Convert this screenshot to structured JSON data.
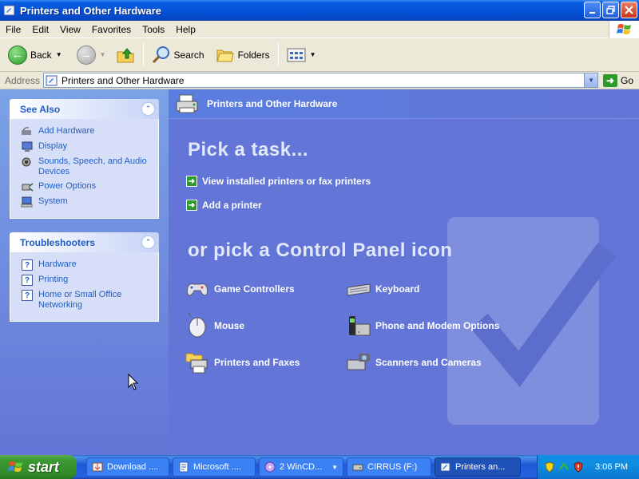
{
  "window": {
    "title": "Printers and Other Hardware"
  },
  "menu": [
    "File",
    "Edit",
    "View",
    "Favorites",
    "Tools",
    "Help"
  ],
  "toolbar": {
    "back": "Back",
    "search": "Search",
    "folders": "Folders"
  },
  "address": {
    "label": "Address",
    "value": "Printers and Other Hardware",
    "go": "Go"
  },
  "see_also": {
    "title": "See Also",
    "items": [
      {
        "label": "Add Hardware",
        "icon": "add-hardware-icon"
      },
      {
        "label": "Display",
        "icon": "display-icon"
      },
      {
        "label": "Sounds, Speech, and Audio Devices",
        "icon": "sounds-icon"
      },
      {
        "label": "Power Options",
        "icon": "power-icon"
      },
      {
        "label": "System",
        "icon": "system-icon"
      }
    ]
  },
  "troubleshooters": {
    "title": "Troubleshooters",
    "items": [
      {
        "label": "Hardware",
        "icon": "help-icon"
      },
      {
        "label": "Printing",
        "icon": "help-icon"
      },
      {
        "label": "Home or Small Office Networking",
        "icon": "help-icon"
      }
    ]
  },
  "content": {
    "banner": "Printers and Other Hardware",
    "pick_task": "Pick a task...",
    "tasks": [
      "View installed printers or fax printers",
      "Add a printer"
    ],
    "pick_icon": "or pick a Control Panel icon",
    "icons": [
      {
        "label": "Game Controllers",
        "icon": "game-controller-icon"
      },
      {
        "label": "Keyboard",
        "icon": "keyboard-icon"
      },
      {
        "label": "Mouse",
        "icon": "mouse-icon"
      },
      {
        "label": "Phone and Modem Options",
        "icon": "phone-modem-icon"
      },
      {
        "label": "Printers and Faxes",
        "icon": "printer-fax-icon"
      },
      {
        "label": "Scanners and Cameras",
        "icon": "scanner-camera-icon"
      }
    ]
  },
  "taskbar": {
    "start": "start",
    "buttons": [
      {
        "label": "Download ...."
      },
      {
        "label": "Microsoft ...."
      },
      {
        "label": "2 WinCD..."
      },
      {
        "label": "CIRRUS (F:)"
      },
      {
        "label": "Printers an..."
      }
    ],
    "clock": "3:06 PM"
  },
  "colors": {
    "panel_blue": "#6375d6",
    "link_blue": "#215dc6",
    "titlebar": "#0653d8",
    "start_green": "#3c9a34"
  }
}
